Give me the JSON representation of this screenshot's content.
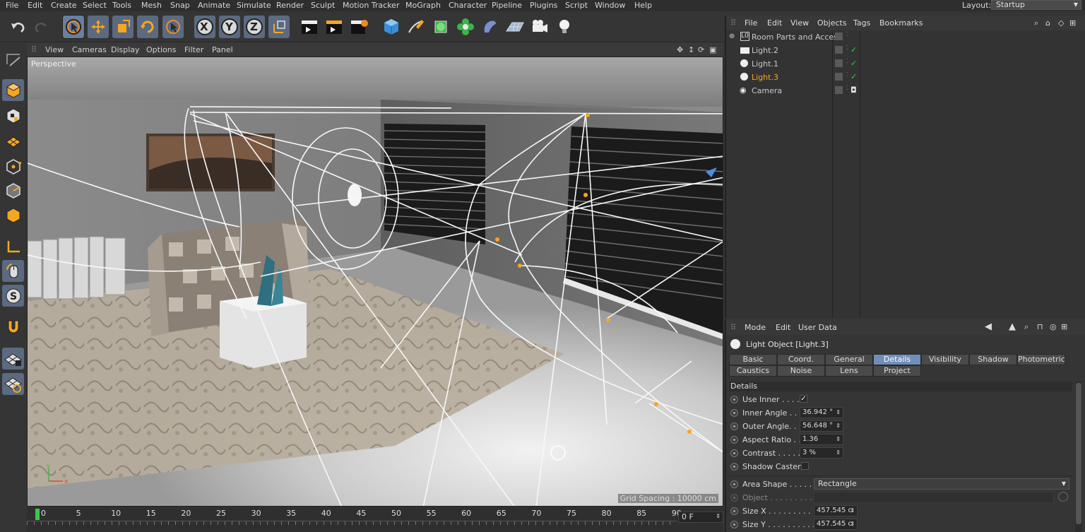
{
  "menubar": {
    "items": [
      "File",
      "Edit",
      "Create",
      "Select",
      "Tools",
      "Mesh",
      "Snap",
      "Animate",
      "Simulate",
      "Render",
      "Sculpt",
      "Motion Tracker",
      "MoGraph",
      "Character",
      "Pipeline",
      "Plugins",
      "Script",
      "Window",
      "Help"
    ],
    "layout_label": "Layout:",
    "layout_value": "Startup"
  },
  "toolbar": {
    "axis_x": "X",
    "axis_y": "Y",
    "axis_z": "Z"
  },
  "viewport": {
    "menu": [
      "View",
      "Cameras",
      "Display",
      "Options",
      "Filter",
      "Panel"
    ],
    "view_name": "Perspective",
    "grid_spacing": "Grid Spacing : 10000 cm"
  },
  "timeline": {
    "ticks": [
      "0",
      "5",
      "10",
      "15",
      "20",
      "25",
      "30",
      "35",
      "40",
      "45",
      "50",
      "55",
      "60",
      "65",
      "70",
      "75",
      "80",
      "85",
      "90"
    ],
    "current_frame": "0 F"
  },
  "object_manager": {
    "menu": [
      "File",
      "Edit",
      "View",
      "Objects",
      "Tags",
      "Bookmarks"
    ],
    "objects": [
      {
        "name": "Room Parts and Acces",
        "color": "#c8c8c8",
        "icon": "null-object-icon",
        "check": ""
      },
      {
        "name": "Light.2",
        "color": "#c8c8c8",
        "icon": "area-light-icon",
        "check": "✓"
      },
      {
        "name": "Light.1",
        "color": "#c8c8c8",
        "icon": "light-icon",
        "check": "✓"
      },
      {
        "name": "Light.3",
        "color": "#f5a623",
        "icon": "light-icon",
        "check": "✓"
      },
      {
        "name": "Camera",
        "color": "#c8c8c8",
        "icon": "camera-icon",
        "check": "◘"
      }
    ]
  },
  "attribute_manager": {
    "menu": [
      "Mode",
      "Edit",
      "User Data"
    ],
    "object_title": "Light Object [Light.3]",
    "tabs_row1": [
      "Basic",
      "Coord.",
      "General",
      "Details",
      "Visibility",
      "Shadow",
      "Photometric"
    ],
    "tabs_row2": [
      "Caustics",
      "Noise",
      "Lens",
      "Project"
    ],
    "active_tab": "Details",
    "section": "Details",
    "props": [
      {
        "label": "Use Inner . . . . .",
        "type": "check",
        "value": "✓"
      },
      {
        "label": "Inner Angle . . .",
        "type": "field",
        "value": "36.942 °"
      },
      {
        "label": "Outer Angle. . .",
        "type": "field",
        "value": "56.648 °"
      },
      {
        "label": "Aspect Ratio  . .",
        "type": "field",
        "value": "1.36"
      },
      {
        "label": "Contrast . . . . . .",
        "type": "field",
        "value": "3 %"
      },
      {
        "label": "Shadow Caster",
        "type": "check",
        "value": ""
      }
    ],
    "area_shape_label": "Area Shape . . . . . .",
    "area_shape_value": "Rectangle",
    "object_label": "Object . . . . . . . . . .",
    "size_x_label": "Size X . . . . . . . . . . .",
    "size_x_value": "457.545 cı",
    "size_y_label": "Size Y . . . . . . . . . . .",
    "size_y_value": "457.545 cı"
  }
}
